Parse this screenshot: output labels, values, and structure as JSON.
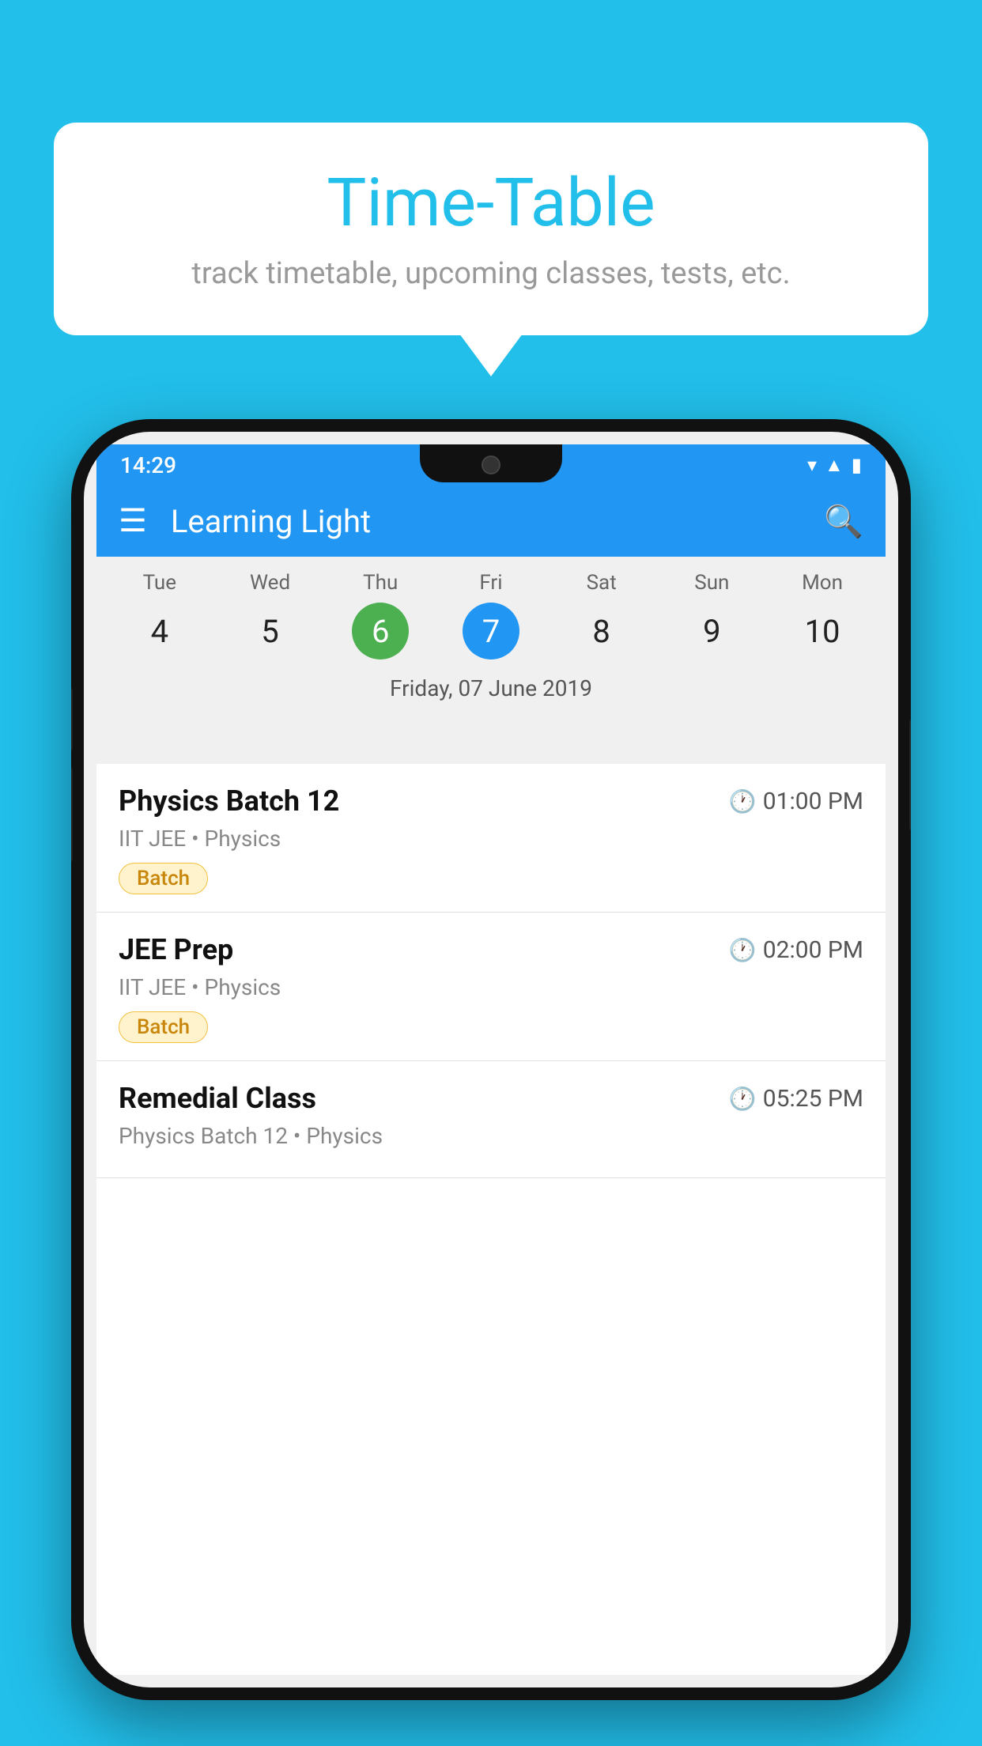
{
  "background_color": "#22BFEA",
  "speech_bubble": {
    "title": "Time-Table",
    "subtitle": "track timetable, upcoming classes, tests, etc."
  },
  "phone": {
    "status_bar": {
      "time": "14:29"
    },
    "app_bar": {
      "title": "Learning Light"
    },
    "calendar": {
      "days": [
        {
          "name": "Tue",
          "num": "4",
          "state": "normal"
        },
        {
          "name": "Wed",
          "num": "5",
          "state": "normal"
        },
        {
          "name": "Thu",
          "num": "6",
          "state": "today"
        },
        {
          "name": "Fri",
          "num": "7",
          "state": "selected"
        },
        {
          "name": "Sat",
          "num": "8",
          "state": "normal"
        },
        {
          "name": "Sun",
          "num": "9",
          "state": "normal"
        },
        {
          "name": "Mon",
          "num": "10",
          "state": "normal"
        }
      ],
      "selected_date_label": "Friday, 07 June 2019"
    },
    "schedule": [
      {
        "title": "Physics Batch 12",
        "time": "01:00 PM",
        "subtitle": "IIT JEE • Physics",
        "badge": "Batch"
      },
      {
        "title": "JEE Prep",
        "time": "02:00 PM",
        "subtitle": "IIT JEE • Physics",
        "badge": "Batch"
      },
      {
        "title": "Remedial Class",
        "time": "05:25 PM",
        "subtitle": "Physics Batch 12 • Physics",
        "badge": null
      }
    ]
  }
}
